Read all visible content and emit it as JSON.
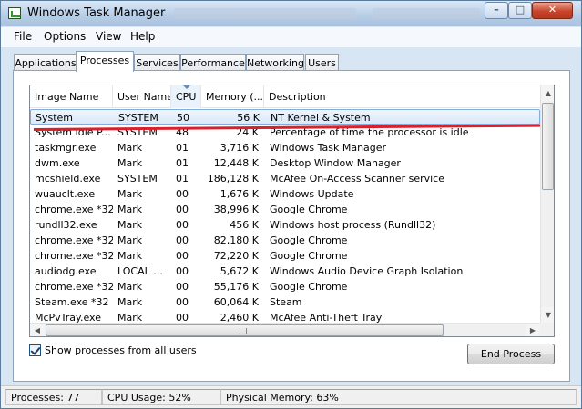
{
  "window": {
    "title": "Windows Task Manager",
    "buttons": {
      "minimize": "–",
      "maximize": "□",
      "close": "✕"
    }
  },
  "menu": [
    "File",
    "Options",
    "View",
    "Help"
  ],
  "tabs": [
    {
      "label": "Applications",
      "active": false
    },
    {
      "label": "Processes",
      "active": true
    },
    {
      "label": "Services",
      "active": false
    },
    {
      "label": "Performance",
      "active": false
    },
    {
      "label": "Networking",
      "active": false
    },
    {
      "label": "Users",
      "active": false
    }
  ],
  "columns": [
    "Image Name",
    "User Name",
    "CPU",
    "Memory (...",
    "Description"
  ],
  "sorted_column": "CPU",
  "processes": [
    {
      "image": "System",
      "user": "SYSTEM",
      "cpu": "50",
      "memory": "56 K",
      "description": "NT Kernel & System",
      "selected": true
    },
    {
      "image": "System Idle P...",
      "user": "SYSTEM",
      "cpu": "48",
      "memory": "24 K",
      "description": "Percentage of time the processor is idle"
    },
    {
      "image": "taskmgr.exe",
      "user": "Mark",
      "cpu": "01",
      "memory": "3,716 K",
      "description": "Windows Task Manager"
    },
    {
      "image": "dwm.exe",
      "user": "Mark",
      "cpu": "01",
      "memory": "12,448 K",
      "description": "Desktop Window Manager"
    },
    {
      "image": "mcshield.exe",
      "user": "SYSTEM",
      "cpu": "01",
      "memory": "186,128 K",
      "description": "McAfee On-Access Scanner service"
    },
    {
      "image": "wuauclt.exe",
      "user": "Mark",
      "cpu": "00",
      "memory": "1,676 K",
      "description": "Windows Update"
    },
    {
      "image": "chrome.exe *32",
      "user": "Mark",
      "cpu": "00",
      "memory": "38,996 K",
      "description": "Google Chrome"
    },
    {
      "image": "rundll32.exe",
      "user": "Mark",
      "cpu": "00",
      "memory": "456 K",
      "description": "Windows host process (Rundll32)"
    },
    {
      "image": "chrome.exe *32",
      "user": "Mark",
      "cpu": "00",
      "memory": "82,180 K",
      "description": "Google Chrome"
    },
    {
      "image": "chrome.exe *32",
      "user": "Mark",
      "cpu": "00",
      "memory": "72,220 K",
      "description": "Google Chrome"
    },
    {
      "image": "audiodg.exe",
      "user": "LOCAL ...",
      "cpu": "00",
      "memory": "5,672 K",
      "description": "Windows Audio Device Graph Isolation"
    },
    {
      "image": "chrome.exe *32",
      "user": "Mark",
      "cpu": "00",
      "memory": "55,176 K",
      "description": "Google Chrome"
    },
    {
      "image": "Steam.exe *32",
      "user": "Mark",
      "cpu": "00",
      "memory": "60,064 K",
      "description": "Steam"
    },
    {
      "image": "McPvTray.exe",
      "user": "Mark",
      "cpu": "00",
      "memory": "2,460 K",
      "description": "McAfee Anti-Theft Tray"
    }
  ],
  "show_all_users": {
    "label": "Show processes from all users",
    "checked": true
  },
  "end_process_label": "End Process",
  "status": {
    "processes": "Processes: 77",
    "cpu_usage": "CPU Usage: 52%",
    "physical_memory": "Physical Memory: 63%"
  },
  "icons": [
    "task-manager-icon",
    "minimize-icon",
    "maximize-icon",
    "close-icon",
    "sort-arrow-icon",
    "scroll-up-icon",
    "scroll-down-icon",
    "scroll-left-icon",
    "scroll-right-icon",
    "checkmark-icon"
  ],
  "colors": {
    "highlight_line": "#d8212c",
    "selection_border": "#84acdd"
  }
}
